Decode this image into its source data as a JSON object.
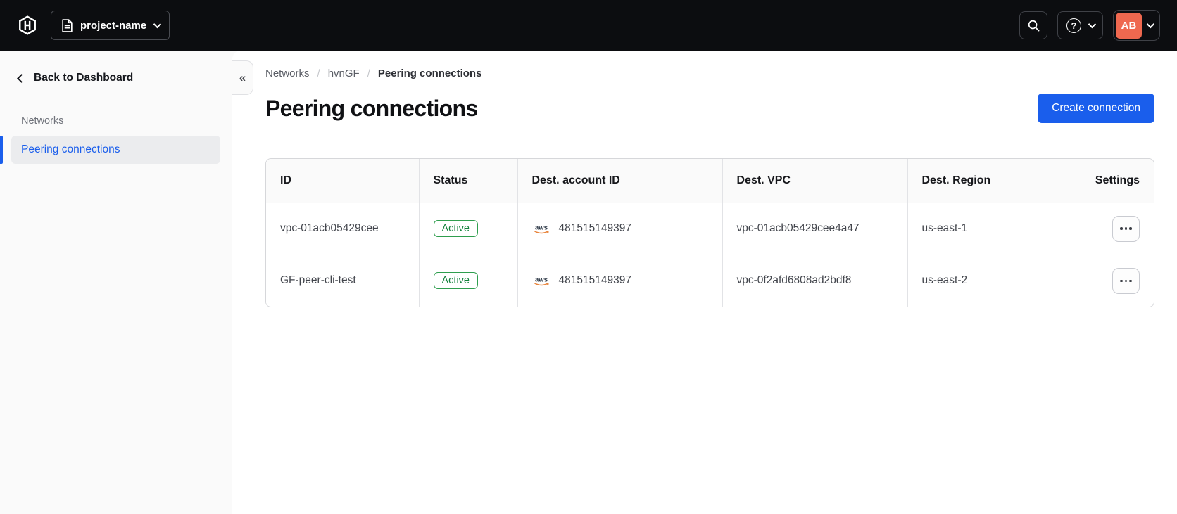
{
  "colors": {
    "accent_blue": "#1a5eec",
    "success_green": "#12813a",
    "avatar_orange": "#ef684f",
    "topbar_black": "#0c0d10"
  },
  "icons": {
    "collapse_glyph": "«",
    "help_glyph": "?"
  },
  "topbar": {
    "project_switcher_label": "project-name",
    "user_initials": "AB"
  },
  "sidebar": {
    "back_label": "Back to Dashboard",
    "section_label": "Networks",
    "items": [
      {
        "label": "Peering connections",
        "active": true
      }
    ]
  },
  "breadcrumb": {
    "items": [
      "Networks",
      "hvnGF",
      "Peering connections"
    ],
    "separator": "/"
  },
  "page": {
    "title": "Peering connections",
    "create_button_label": "Create connection"
  },
  "table": {
    "columns": [
      "ID",
      "Status",
      "Dest. account ID",
      "Dest. VPC",
      "Dest. Region",
      "Settings"
    ],
    "rows": [
      {
        "id": "vpc-01acb05429cee",
        "status": "Active",
        "dest_account_provider": "aws",
        "dest_account_id": "481515149397",
        "dest_vpc": "vpc-01acb05429cee4a47",
        "dest_region": "us-east-1"
      },
      {
        "id": "GF-peer-cli-test",
        "status": "Active",
        "dest_account_provider": "aws",
        "dest_account_id": "481515149397",
        "dest_vpc": "vpc-0f2afd6808ad2bdf8",
        "dest_region": "us-east-2"
      }
    ]
  }
}
